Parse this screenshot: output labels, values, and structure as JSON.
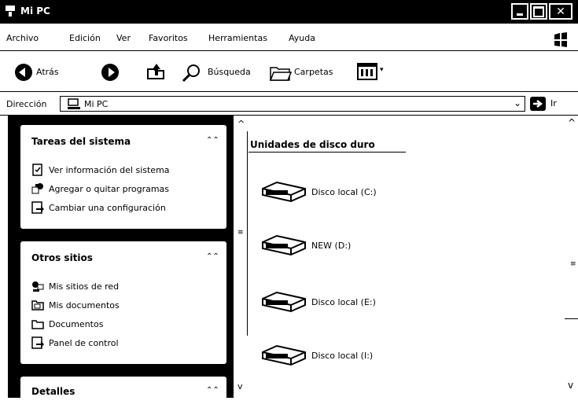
{
  "window": {
    "title": "Mi PC"
  },
  "menu": [
    "Archivo",
    "Edición",
    "Ver",
    "Favoritos",
    "Herramientas",
    "Ayuda"
  ],
  "toolbar": {
    "back": "Atrás",
    "search": "Búsqueda",
    "folders": "Carpetas"
  },
  "address": {
    "label": "Dirección",
    "value": "Mi PC",
    "go": "Ir"
  },
  "tasks_panel": {
    "title": "Tareas del sistema",
    "items": [
      "Ver información del sistema",
      "Agregar o quitar programas",
      "Cambiar una configuración"
    ]
  },
  "places_panel": {
    "title": "Otros sitios",
    "items": [
      "Mis sitios de red",
      "Mis documentos",
      "Documentos",
      "Panel de control"
    ]
  },
  "details_panel": {
    "title": "Detalles"
  },
  "content": {
    "group_title": "Unidades de disco duro",
    "drives": [
      "Disco local (C:)",
      "NEW (D:)",
      "Disco local (E:)",
      "Disco local (I:)"
    ]
  }
}
